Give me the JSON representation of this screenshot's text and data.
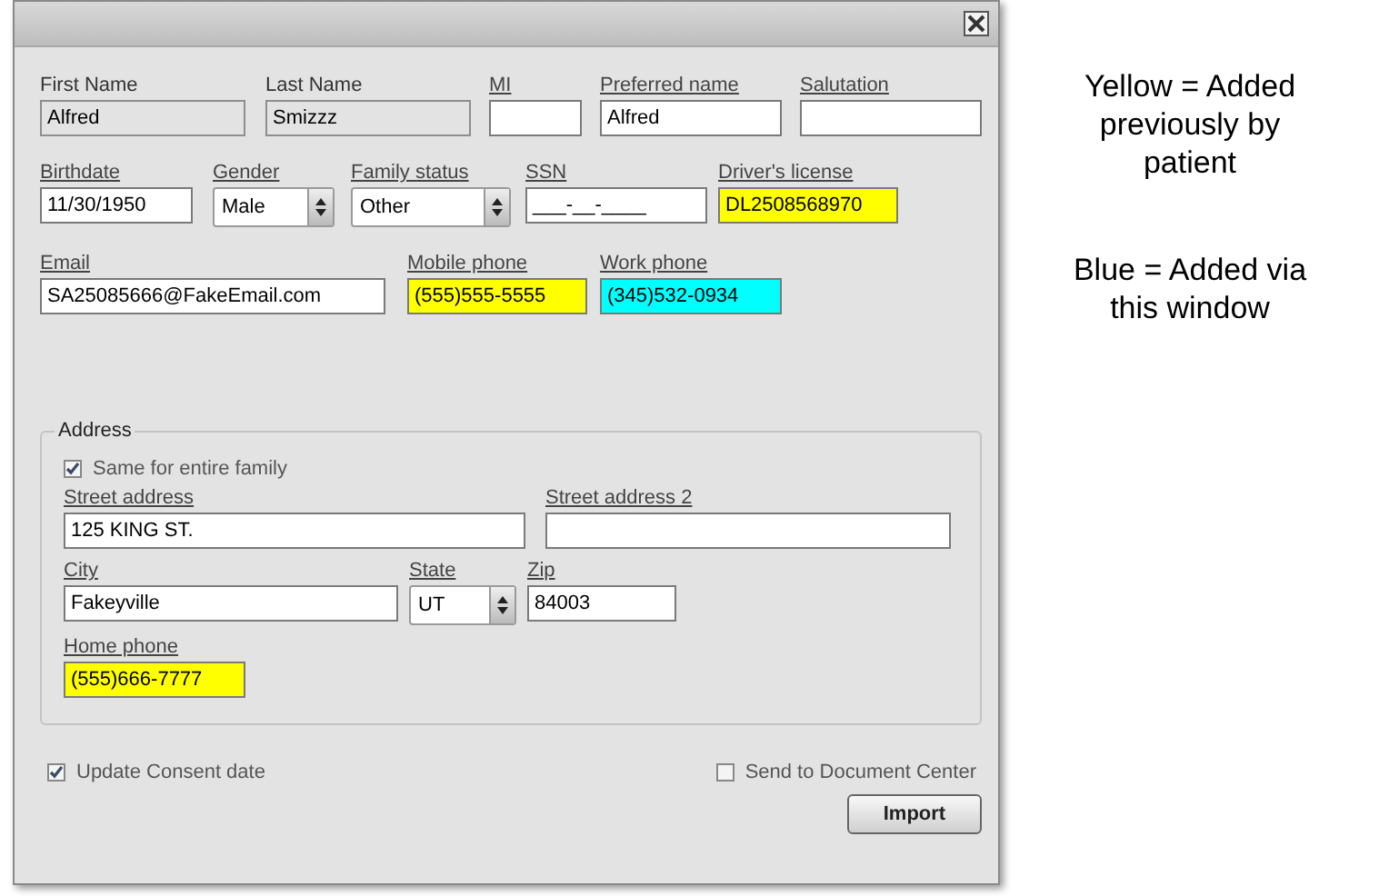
{
  "fields": [
    {
      "label": "First Name",
      "underlined": false,
      "value": "Alfred",
      "kind": "text",
      "readonly": true
    },
    {
      "label": "Last Name",
      "underlined": false,
      "value": "Smizzz",
      "kind": "text",
      "readonly": true
    },
    {
      "label": "MI",
      "underlined": true,
      "kind": "text",
      "readonly": false
    },
    {
      "label": "Preferred name",
      "underlined": true,
      "value": "Alfred",
      "kind": "text",
      "readonly": false
    },
    {
      "label": "Salutation",
      "underlined": true,
      "kind": "text",
      "readonly": false
    },
    {
      "label": "Birthdate",
      "underlined": true,
      "value": "11/30/1950",
      "kind": "text",
      "readonly": false
    },
    {
      "label": "Gender",
      "underlined": true,
      "value": "Male",
      "kind": "select",
      "readonly": false
    },
    {
      "label": "Family status",
      "underlined": true,
      "value": "Other",
      "kind": "select",
      "readonly": false
    },
    {
      "label": "SSN",
      "underlined": true,
      "value": "___-__-____",
      "kind": "text",
      "readonly": false
    },
    {
      "label": "Driver's license",
      "underlined": true,
      "value": "DL2508568970",
      "kind": "text",
      "readonly": false,
      "color": "#ffff00"
    },
    {
      "label": "Email",
      "underlined": true,
      "value": "SA25085666@FakeEmail.com",
      "kind": "text",
      "readonly": false
    },
    {
      "label": "Mobile phone",
      "underlined": true,
      "value": "(555)555-5555",
      "kind": "text",
      "readonly": false,
      "color": "#ffff00"
    },
    {
      "label": "Work phone",
      "underlined": true,
      "value": "(345)532-0934",
      "kind": "text",
      "readonly": false,
      "color": "#00ffff"
    }
  ],
  "address": {
    "title": "Address",
    "same_for_family": {
      "label": "Same for entire family",
      "checked": true
    },
    "fields": [
      {
        "label": "Street address",
        "underlined": true,
        "value": "125 KING ST.",
        "kind": "text",
        "readonly": false
      },
      {
        "label": "Street address 2",
        "underlined": true,
        "kind": "text",
        "readonly": false
      },
      {
        "label": "City",
        "underlined": true,
        "value": "Fakeyville",
        "kind": "text",
        "readonly": false
      },
      {
        "label": "State",
        "underlined": true,
        "value": "UT",
        "kind": "select",
        "readonly": false
      },
      {
        "label": "Zip",
        "underlined": true,
        "value": "84003",
        "kind": "text",
        "readonly": false
      },
      {
        "label": "Home phone",
        "underlined": true,
        "value": "(555)666-7777",
        "kind": "text",
        "readonly": false,
        "color": "#ffff00"
      }
    ]
  },
  "options": [
    {
      "label": "Update Consent date",
      "checked": true
    },
    {
      "label": "Send to Document Center",
      "checked": false
    }
  ],
  "buttons": [
    "Import"
  ],
  "notes": [
    "Yellow = Added previously by patient",
    "Blue = Added via this window"
  ]
}
